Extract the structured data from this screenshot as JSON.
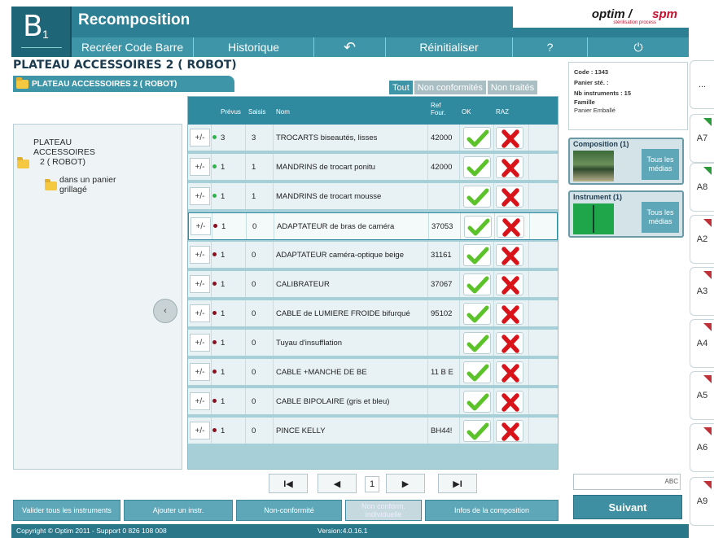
{
  "app": {
    "logo_letter": "B",
    "logo_num": "1",
    "title": "Recomposition",
    "brand_a": "optim /",
    "brand_b": "spm",
    "brand_sub": "stérilisation process"
  },
  "menu": [
    {
      "label": "Recréer Code Barre"
    },
    {
      "label": "Historique"
    },
    {
      "label": "↶"
    },
    {
      "label": "Réinitialiser"
    },
    {
      "label": "?"
    },
    {
      "label": "⏻"
    }
  ],
  "page_title": "PLATEAU ACCESSOIRES 2  ( ROBOT)",
  "breadcrumb": "PLATEAU ACCESSOIRES 2  ( ROBOT)",
  "filter_tabs": [
    "Tout",
    "Non conformités",
    "Non traités"
  ],
  "tree": {
    "root": [
      "PLATEAU",
      "ACCESSOIRES",
      "2  ( ROBOT)"
    ],
    "child": [
      "dans un panier",
      "grillagé"
    ]
  },
  "table": {
    "headers": {
      "prevus": "Prévus",
      "saisis": "Saisis",
      "nom": "Nom",
      "ref": "Ref Four.",
      "ok": "OK",
      "raz": "RAZ"
    },
    "rows": [
      {
        "pm": "+/-",
        "prevus": "3",
        "saisis": "3",
        "nom": "TROCARTS biseautés, lisses",
        "ref": "42000",
        "status": "ok"
      },
      {
        "pm": "+/-",
        "prevus": "1",
        "saisis": "1",
        "nom": "MANDRINS de trocart ponitu",
        "ref": "42000",
        "status": "ok"
      },
      {
        "pm": "+/-",
        "prevus": "1",
        "saisis": "1",
        "nom": "MANDRINS de trocart mousse",
        "ref": "",
        "status": "ok"
      },
      {
        "pm": "+/-",
        "prevus": "1",
        "saisis": "0",
        "nom": "ADAPTATEUR de bras de caméra",
        "ref": "37053",
        "status": "missing"
      },
      {
        "pm": "+/-",
        "prevus": "1",
        "saisis": "0",
        "nom": "ADAPTATEUR caméra-optique beige",
        "ref": "31161",
        "status": "missing"
      },
      {
        "pm": "+/-",
        "prevus": "1",
        "saisis": "0",
        "nom": "CALIBRATEUR",
        "ref": "37067",
        "status": "missing"
      },
      {
        "pm": "+/-",
        "prevus": "1",
        "saisis": "0",
        "nom": "CABLE de LUMIERE FROIDE bifurqué",
        "ref": "95102",
        "status": "missing"
      },
      {
        "pm": "+/-",
        "prevus": "1",
        "saisis": "0",
        "nom": "Tuyau d'insufflation",
        "ref": "",
        "status": "missing"
      },
      {
        "pm": "+/-",
        "prevus": "1",
        "saisis": "0",
        "nom": "CABLE +MANCHE DE BE",
        "ref": "11 B E",
        "status": "missing"
      },
      {
        "pm": "+/-",
        "prevus": "1",
        "saisis": "0",
        "nom": "CABLE BIPOLAIRE (gris et bleu)",
        "ref": "",
        "status": "missing"
      },
      {
        "pm": "+/-",
        "prevus": "1",
        "saisis": "0",
        "nom": "PINCE KELLY",
        "ref": "BH44!",
        "status": "missing"
      }
    ]
  },
  "pager": {
    "first": "I◀",
    "prev": "◀",
    "page": "1",
    "next": "▶",
    "last": "▶I"
  },
  "bottom_buttons": [
    "Valider tous les instruments",
    "Ajouter un instr.",
    "Non-conformité",
    "Non conform. individuelle",
    "Infos de la composition"
  ],
  "footer": {
    "copyright": "Copyright © Optim 2011 - Support 0 826 108 008",
    "version": "Version:4.0.16.1"
  },
  "info": {
    "code": "Code : 1343",
    "panier": "Panier sté. :",
    "nb": "Nb instruments : 15",
    "famille_label": "Famille",
    "famille_value": "Panier Emballé"
  },
  "composition": {
    "title": "Composition (1)",
    "tous": "Tous les médias"
  },
  "instrument": {
    "title": "Instrument (1)",
    "tous": "Tous les médias"
  },
  "search": {
    "abc": "ABC"
  },
  "next_label": "Suivant",
  "side_tabs": [
    "...",
    "A7",
    "A8",
    "A2",
    "A3",
    "A4",
    "A5",
    "A6",
    "A9"
  ],
  "colors": {
    "header": "#2d7f93",
    "accent": "#3e95a8",
    "ok_green": "#5cc22a",
    "raz_red": "#d8141a"
  }
}
